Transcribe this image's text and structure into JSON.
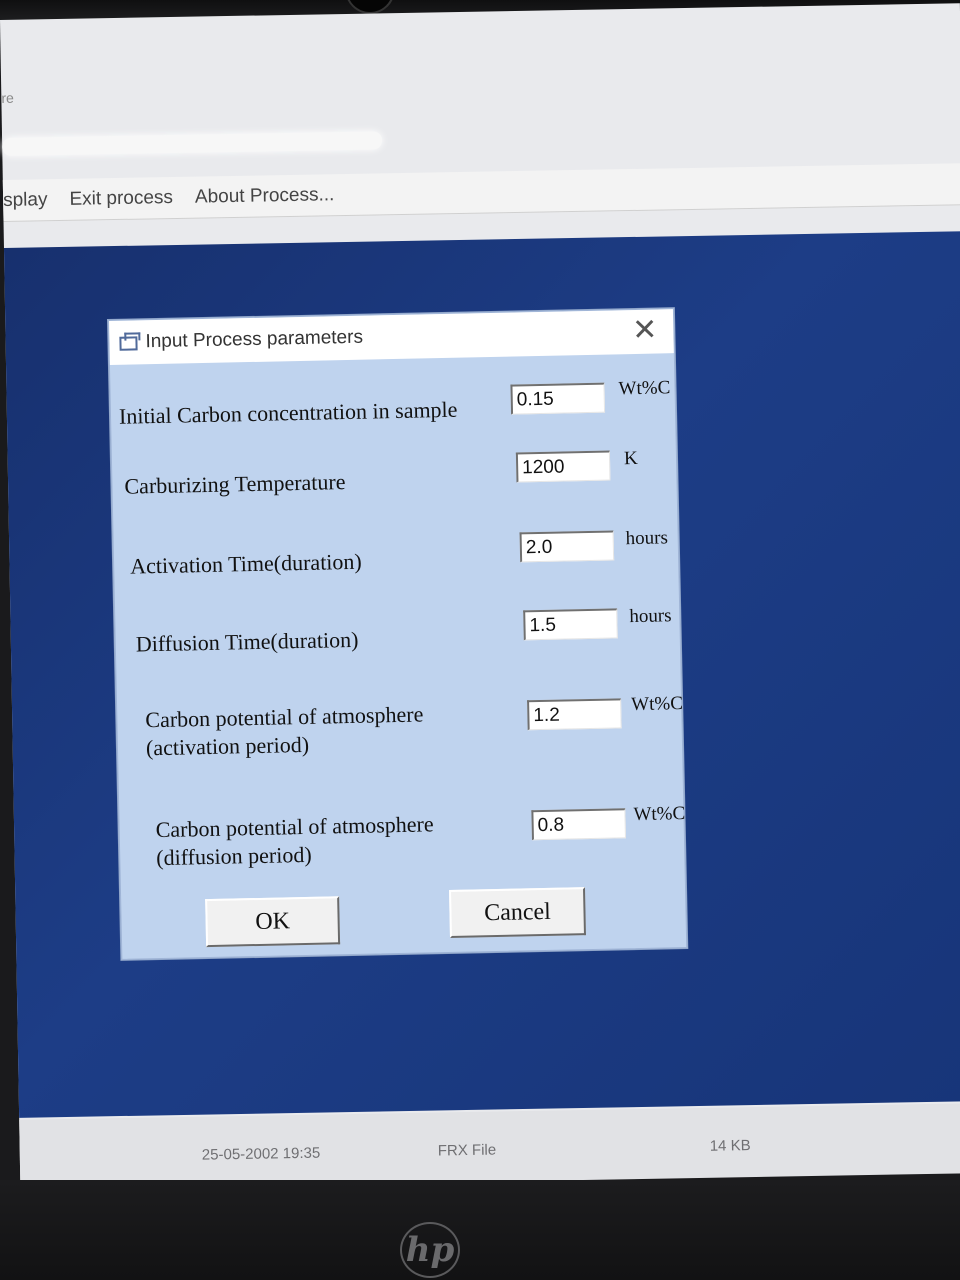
{
  "window": {
    "title_fragment": "re"
  },
  "menubar": {
    "items": [
      {
        "label": "splay"
      },
      {
        "label": "Exit process"
      },
      {
        "label": "About Process..."
      }
    ]
  },
  "dialog": {
    "title": "Input Process parameters",
    "close_glyph": "✕",
    "rows": [
      {
        "label": "Initial Carbon concentration in sample",
        "value": "0.15",
        "unit": "Wt%C"
      },
      {
        "label": "Carburizing Temperature",
        "value": "1200",
        "unit": "K"
      },
      {
        "label": "Activation Time(duration)",
        "value": "2.0",
        "unit": "hours"
      },
      {
        "label": "Diffusion Time(duration)",
        "value": "1.5",
        "unit": "hours"
      },
      {
        "label": "Carbon potential of atmosphere",
        "label2": "(activation period)",
        "value": "1.2",
        "unit": "Wt%C"
      },
      {
        "label": "Carbon potential of atmosphere",
        "label2": "(diffusion period)",
        "value": "0.8",
        "unit": "Wt%C"
      }
    ],
    "ok_label": "OK",
    "cancel_label": "Cancel"
  },
  "statusbar": {
    "date": "25-05-2002 19:35",
    "type": "FRX File",
    "size": "14 KB"
  },
  "bezel": {
    "logo": "hp"
  },
  "colors": {
    "workspace": "#1d3d86",
    "dialog_bg": "#bfd3ee"
  }
}
